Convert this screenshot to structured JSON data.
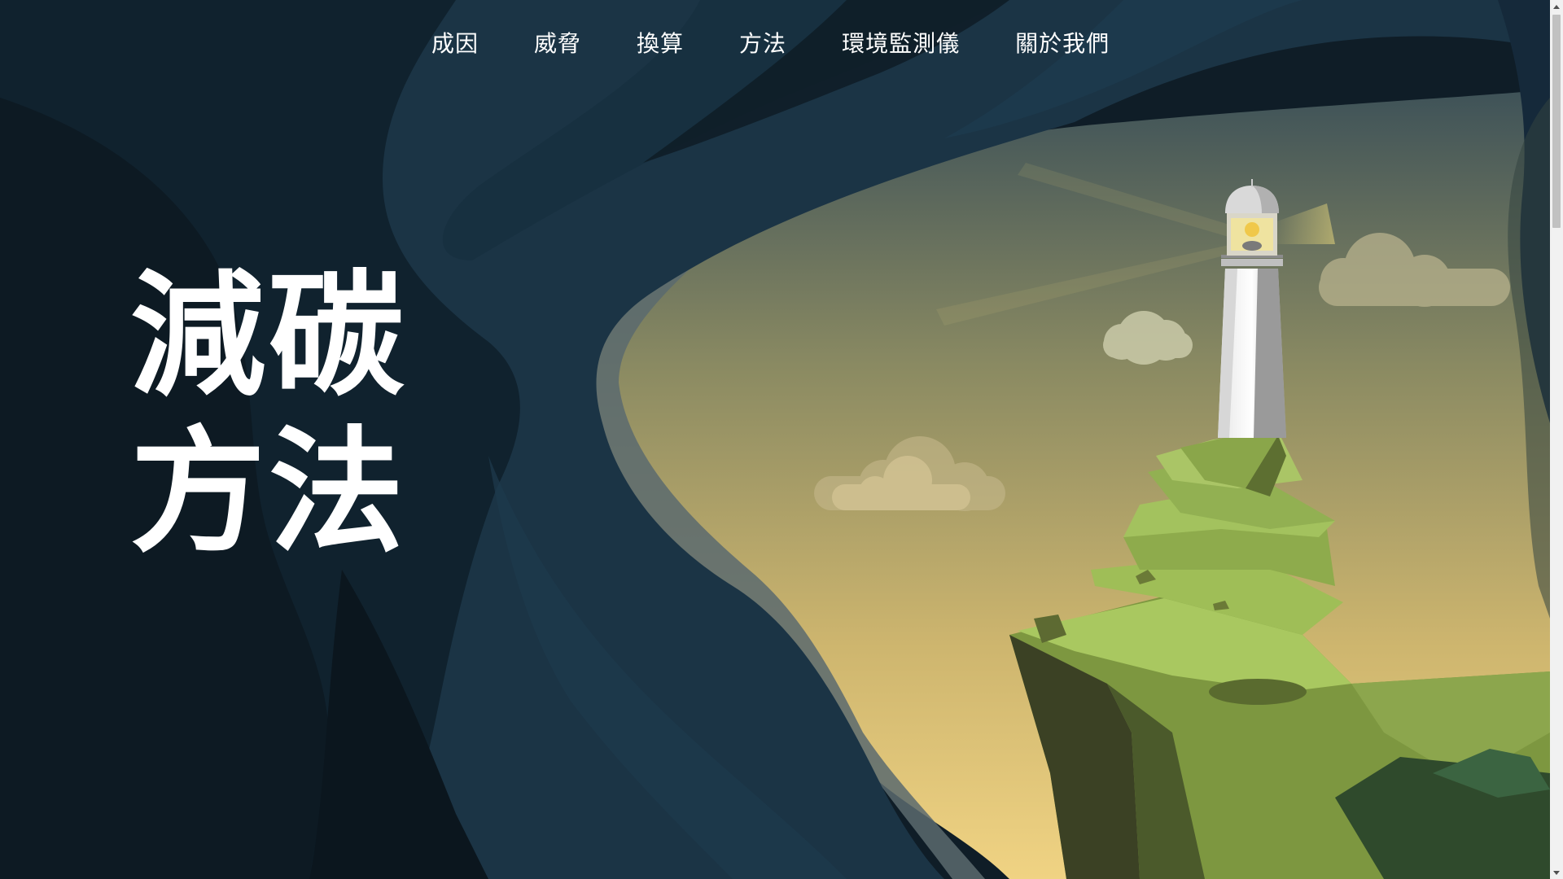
{
  "nav": {
    "items": [
      {
        "label": "成因"
      },
      {
        "label": "威脅"
      },
      {
        "label": "換算"
      },
      {
        "label": "方法"
      },
      {
        "label": "環境監測儀"
      },
      {
        "label": "關於我們"
      }
    ]
  },
  "hero": {
    "title_line1": "減碳",
    "title_line2": "方法"
  },
  "colors": {
    "cave_dark": "#0f1d27",
    "cave_mid": "#1a3242",
    "sky_top": "#46585a",
    "sky_bottom": "#ecd184",
    "cliff_green": "#a6c25d"
  },
  "icons": {
    "scroll_up": "scroll-up-arrow-icon",
    "scroll_down": "scroll-down-arrow-icon"
  }
}
